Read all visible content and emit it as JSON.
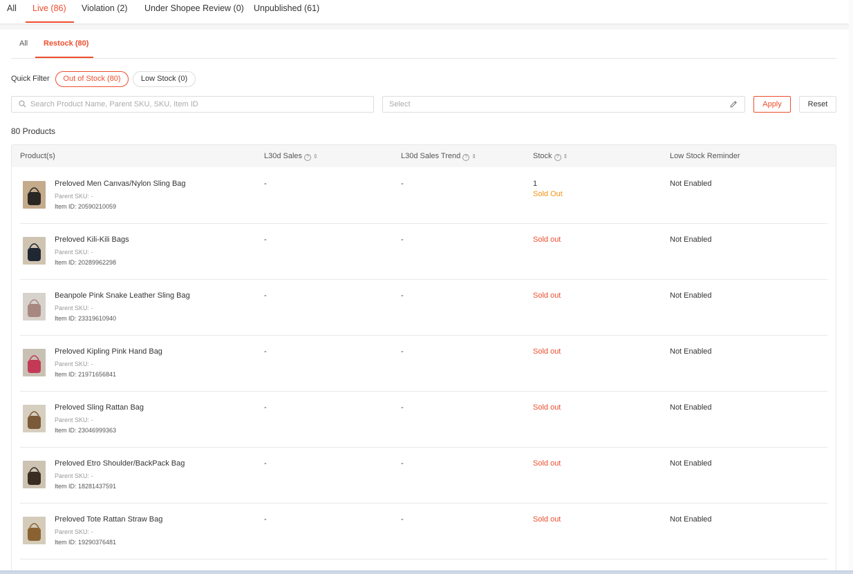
{
  "top_tabs": [
    {
      "label": "All"
    },
    {
      "label": "Live (86)"
    },
    {
      "label": "Violation (2)"
    },
    {
      "label": "Under Shopee Review (0)"
    },
    {
      "label": "Unpublished (61)"
    }
  ],
  "sub_tabs": [
    {
      "label": "All"
    },
    {
      "label": "Restock (80)"
    }
  ],
  "quick_filter": {
    "label": "Quick Filter",
    "pills": [
      {
        "label": "Out of Stock (80)",
        "active": true
      },
      {
        "label": "Low Stock (0)",
        "active": false
      }
    ]
  },
  "search": {
    "placeholder": "Search Product Name, Parent SKU, SKU, Item ID",
    "value": ""
  },
  "select": {
    "placeholder": "Select"
  },
  "buttons": {
    "apply": "Apply",
    "reset": "Reset"
  },
  "product_count": "80 Products",
  "table": {
    "headers": {
      "product": "Product(s)",
      "l30d_sales": "L30d Sales",
      "l30d_trend": "L30d Sales Trend",
      "stock": "Stock",
      "reminder": "Low Stock Reminder"
    },
    "rows": [
      {
        "name": "Preloved Men Canvas/Nylon Sling Bag",
        "parent_sku": "Parent SKU: -",
        "item_id": "Item ID: 20590210059",
        "sales": "-",
        "trend": "-",
        "stock_qty": "1",
        "stock_status": "Sold Out",
        "reminder": "Not Enabled",
        "thumb_bg": "#c4ab8c",
        "bag_color": "#2a2622",
        "icon": "sling-bag-thumbnail-icon"
      },
      {
        "name": "Preloved Kili-Kili Bags",
        "parent_sku": "Parent SKU: -",
        "item_id": "Item ID: 20289962298",
        "sales": "-",
        "trend": "-",
        "stock_qty": "",
        "stock_status": "Sold out",
        "reminder": "Not Enabled",
        "thumb_bg": "#cfc4b2",
        "bag_color": "#1f2733",
        "icon": "kili-bags-thumbnail-icon"
      },
      {
        "name": "Beanpole Pink Snake Leather Sling Bag",
        "parent_sku": "Parent SKU: -",
        "item_id": "Item ID: 23319610940",
        "sales": "-",
        "trend": "-",
        "stock_qty": "",
        "stock_status": "Sold out",
        "reminder": "Not Enabled",
        "thumb_bg": "#d8d2cc",
        "bag_color": "#a88781",
        "icon": "snake-bag-thumbnail-icon"
      },
      {
        "name": "Preloved Kipling Pink Hand Bag",
        "parent_sku": "Parent SKU: -",
        "item_id": "Item ID: 21971656841",
        "sales": "-",
        "trend": "-",
        "stock_qty": "",
        "stock_status": "Sold out",
        "reminder": "Not Enabled",
        "thumb_bg": "#c9c0b4",
        "bag_color": "#c23a55",
        "icon": "kipling-bag-thumbnail-icon"
      },
      {
        "name": "Preloved Sling Rattan Bag",
        "parent_sku": "Parent SKU: -",
        "item_id": "Item ID: 23046999363",
        "sales": "-",
        "trend": "-",
        "stock_qty": "",
        "stock_status": "Sold out",
        "reminder": "Not Enabled",
        "thumb_bg": "#d6cebf",
        "bag_color": "#7a5a38",
        "icon": "rattan-sling-thumbnail-icon"
      },
      {
        "name": "Preloved Etro Shoulder/BackPack Bag",
        "parent_sku": "Parent SKU: -",
        "item_id": "Item ID: 18281437591",
        "sales": "-",
        "trend": "-",
        "stock_qty": "",
        "stock_status": "Sold out",
        "reminder": "Not Enabled",
        "thumb_bg": "#cdc3b2",
        "bag_color": "#3a2c20",
        "icon": "etro-bag-thumbnail-icon"
      },
      {
        "name": "Preloved Tote Rattan Straw Bag",
        "parent_sku": "Parent SKU: -",
        "item_id": "Item ID: 19290376481",
        "sales": "-",
        "trend": "-",
        "stock_qty": "",
        "stock_status": "Sold out",
        "reminder": "Not Enabled",
        "thumb_bg": "#d4cbba",
        "bag_color": "#8a6232",
        "icon": "straw-tote-thumbnail-icon"
      }
    ]
  },
  "colors": {
    "accent": "#ee4d2d",
    "sold_out_orange": "#f69113"
  }
}
